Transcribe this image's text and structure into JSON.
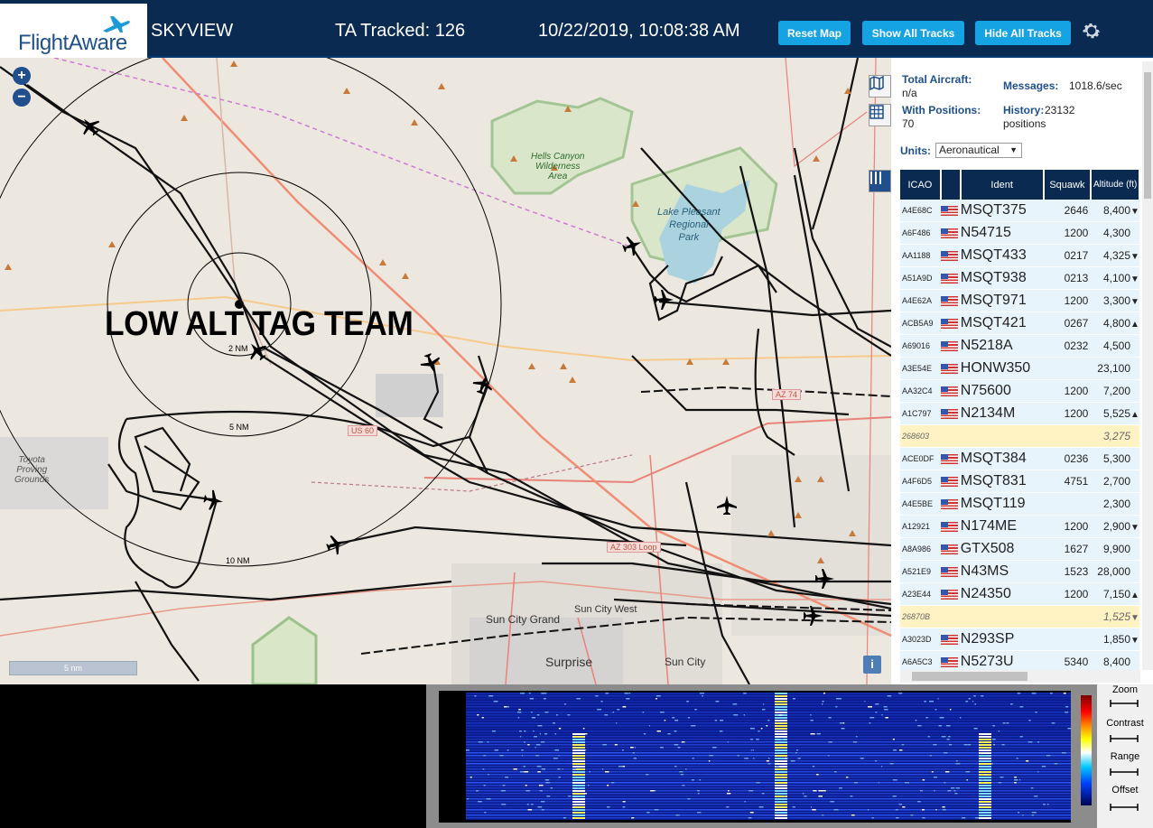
{
  "header": {
    "logo_text": "FlightAware",
    "app_name": "SKYVIEW",
    "tracked": "TA Tracked: 126",
    "datetime": "10/22/2019, 10:08:38 AM",
    "buttons": {
      "reset": "Reset Map",
      "show": "Show All Tracks",
      "hide": "Hide All Tracks"
    },
    "settings_icon": "gear-icon"
  },
  "map": {
    "zoom_in": "+",
    "zoom_out": "−",
    "overlay_text": "LOW ALT TAG TEAM",
    "scale_label": "5 nm",
    "info": "i",
    "range_rings": [
      "2 NM",
      "5 NM",
      "10 NM"
    ],
    "labels": {
      "hells_canyon": "Hells Canyon\nWilderness\nArea",
      "lake_pleasant": "Lake Pleasant\nRegional\nPark",
      "toyota": "Toyota\nProving\nGrounds",
      "sun_city_grand": "Sun City Grand",
      "sun_city_west": "Sun City West",
      "surprise": "Surprise",
      "sun_city": "Sun City",
      "us60": "US 60",
      "az74": "AZ 74",
      "az303": "AZ 303 Loop"
    },
    "tools": [
      "map-layers-icon",
      "grid-icon",
      "columns-icon"
    ]
  },
  "panel": {
    "total_aircraft_label": "Total Aircraft:",
    "total_aircraft_value": "n/a",
    "with_positions_label": "With Positions:",
    "with_positions_value": "70",
    "messages_label": "Messages:",
    "messages_value": "1018.6/sec",
    "history_label": "History:",
    "history_value": "23132 positions",
    "units_label": "Units:",
    "units_value": "Aeronautical",
    "columns": {
      "icao": "ICAO",
      "ident": "Ident",
      "squawk": "Squawk",
      "altitude": "Altitude (ft)"
    },
    "rows": [
      {
        "icao": "A4E68C",
        "ident": "MSQT375",
        "squawk": "2646",
        "alt": "8,400",
        "trend": "▼",
        "mlat": false
      },
      {
        "icao": "A6F486",
        "ident": "N54715",
        "squawk": "1200",
        "alt": "4,300",
        "trend": "",
        "mlat": false
      },
      {
        "icao": "AA1188",
        "ident": "MSQT433",
        "squawk": "0217",
        "alt": "4,325",
        "trend": "▼",
        "mlat": false
      },
      {
        "icao": "A51A9D",
        "ident": "MSQT938",
        "squawk": "0213",
        "alt": "4,100",
        "trend": "▼",
        "mlat": false
      },
      {
        "icao": "A4E62A",
        "ident": "MSQT971",
        "squawk": "1200",
        "alt": "3,300",
        "trend": "▼",
        "mlat": false
      },
      {
        "icao": "ACB5A9",
        "ident": "MSQT421",
        "squawk": "0267",
        "alt": "4,800",
        "trend": "▲",
        "mlat": false
      },
      {
        "icao": "A69016",
        "ident": "N5218A",
        "squawk": "0232",
        "alt": "4,500",
        "trend": "",
        "mlat": false
      },
      {
        "icao": "A3E54E",
        "ident": "HONW350",
        "squawk": "",
        "alt": "23,100",
        "trend": "",
        "mlat": false
      },
      {
        "icao": "AA32C4",
        "ident": "N75600",
        "squawk": "1200",
        "alt": "7,200",
        "trend": "",
        "mlat": false
      },
      {
        "icao": "A1C797",
        "ident": "N2134M",
        "squawk": "1200",
        "alt": "5,525",
        "trend": "▲",
        "mlat": false
      },
      {
        "icao": "268603",
        "ident": "",
        "squawk": "",
        "alt": "3,275",
        "trend": "",
        "mlat": true
      },
      {
        "icao": "ACE0DF",
        "ident": "MSQT384",
        "squawk": "0236",
        "alt": "5,300",
        "trend": "",
        "mlat": false
      },
      {
        "icao": "A4F6D5",
        "ident": "MSQT831",
        "squawk": "4751",
        "alt": "2,700",
        "trend": "",
        "mlat": false
      },
      {
        "icao": "A4E5BE",
        "ident": "MSQT119",
        "squawk": "",
        "alt": "2,300",
        "trend": "",
        "mlat": false
      },
      {
        "icao": "A12921",
        "ident": "N174ME",
        "squawk": "1200",
        "alt": "2,900",
        "trend": "▼",
        "mlat": false
      },
      {
        "icao": "A8A986",
        "ident": "GTX508",
        "squawk": "1627",
        "alt": "9,900",
        "trend": "",
        "mlat": false
      },
      {
        "icao": "A521E9",
        "ident": "N43MS",
        "squawk": "1523",
        "alt": "28,000",
        "trend": "",
        "mlat": false
      },
      {
        "icao": "A23E44",
        "ident": "N24350",
        "squawk": "1200",
        "alt": "7,150",
        "trend": "▲",
        "mlat": false
      },
      {
        "icao": "26870B",
        "ident": "",
        "squawk": "",
        "alt": "1,525",
        "trend": "▼",
        "mlat": true
      },
      {
        "icao": "A3023D",
        "ident": "N293SP",
        "squawk": "",
        "alt": "1,850",
        "trend": "▼",
        "mlat": false
      },
      {
        "icao": "A6A5C3",
        "ident": "N5273U",
        "squawk": "5340",
        "alt": "8,400",
        "trend": "",
        "mlat": false
      }
    ]
  },
  "waterfall": {
    "controls": [
      "Zoom",
      "Contrast",
      "Range",
      "Offset"
    ]
  }
}
